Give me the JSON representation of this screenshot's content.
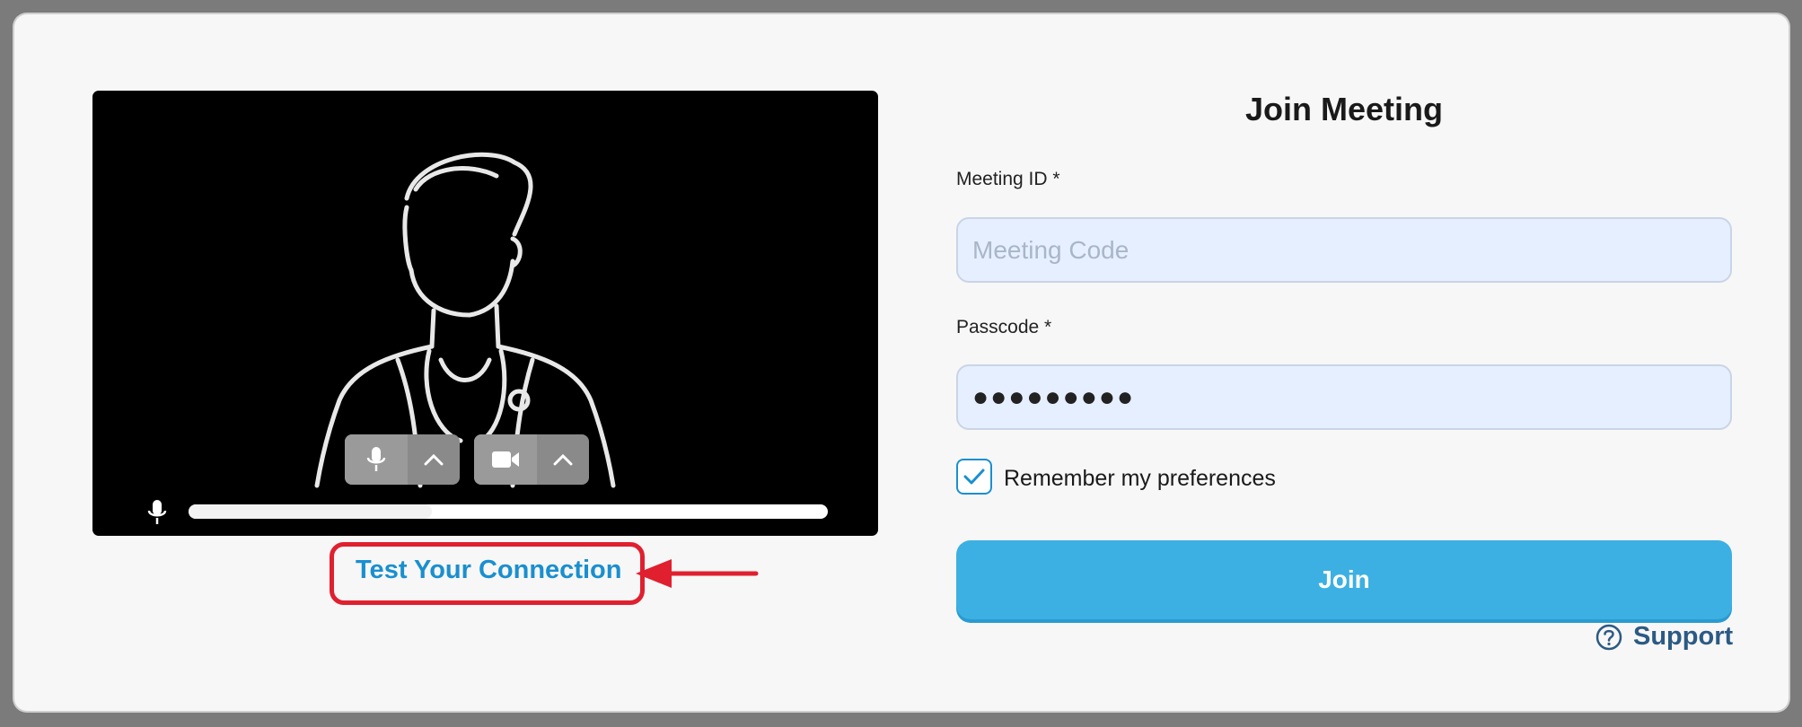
{
  "video_preview": {
    "mic_control": "microphone-icon",
    "mic_menu": "chevron-up-icon",
    "camera_control": "video-camera-icon",
    "camera_menu": "chevron-up-icon",
    "audio_level": 0.38
  },
  "test_connection": {
    "label": "Test Your Connection"
  },
  "form": {
    "title": "Join Meeting",
    "meeting_id": {
      "label": "Meeting ID *",
      "placeholder": "Meeting Code",
      "value": ""
    },
    "passcode": {
      "label": "Passcode *",
      "value": "●●●●●●●●●"
    },
    "remember": {
      "label": "Remember my preferences",
      "checked": true
    },
    "join_label": "Join",
    "support_label": "Support"
  },
  "colors": {
    "accent": "#1a8fcf",
    "join_button": "#3cb0e2",
    "annotation_red": "#e0202f",
    "support_text": "#2c5a84"
  }
}
